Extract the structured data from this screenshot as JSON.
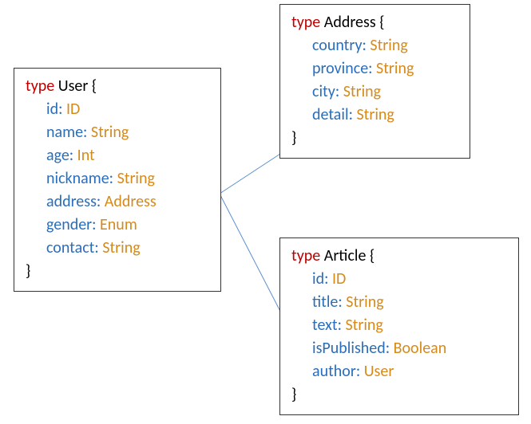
{
  "keywords": {
    "type": "type"
  },
  "user": {
    "name": "User",
    "open": "{",
    "close": "}",
    "fields": {
      "id": {
        "name": "id",
        "colon": ":",
        "type": "ID"
      },
      "name": {
        "name": "name",
        "colon": ":",
        "type": "String"
      },
      "age": {
        "name": "age",
        "colon": ":",
        "type": "Int"
      },
      "nickname": {
        "name": "nickname",
        "colon": ":",
        "type": "String"
      },
      "address": {
        "name": "address",
        "colon": ":",
        "type": "Address"
      },
      "gender": {
        "name": "gender",
        "colon": ":",
        "type": "Enum"
      },
      "contact": {
        "name": "contact",
        "colon": ":",
        "type": "String"
      }
    }
  },
  "address": {
    "name": "Address",
    "open": "{",
    "close": "}",
    "fields": {
      "country": {
        "name": "country",
        "colon": ":",
        "type": "String"
      },
      "province": {
        "name": "province",
        "colon": ":",
        "type": "String"
      },
      "city": {
        "name": "city",
        "colon": ":",
        "type": "String"
      },
      "detail": {
        "name": "detail",
        "colon": ":",
        "type": "String"
      }
    }
  },
  "article": {
    "name": "Article",
    "open": "{",
    "close": "}",
    "fields": {
      "id": {
        "name": "id",
        "colon": ":",
        "type": "ID"
      },
      "title": {
        "name": "title",
        "colon": ":",
        "type": "String"
      },
      "text": {
        "name": "text",
        "colon": ":",
        "type": "String"
      },
      "isPublished": {
        "name": "isPublished",
        "colon": ":",
        "type": "Boolean"
      },
      "author": {
        "name": "author",
        "colon": ":",
        "type": "User"
      }
    }
  }
}
